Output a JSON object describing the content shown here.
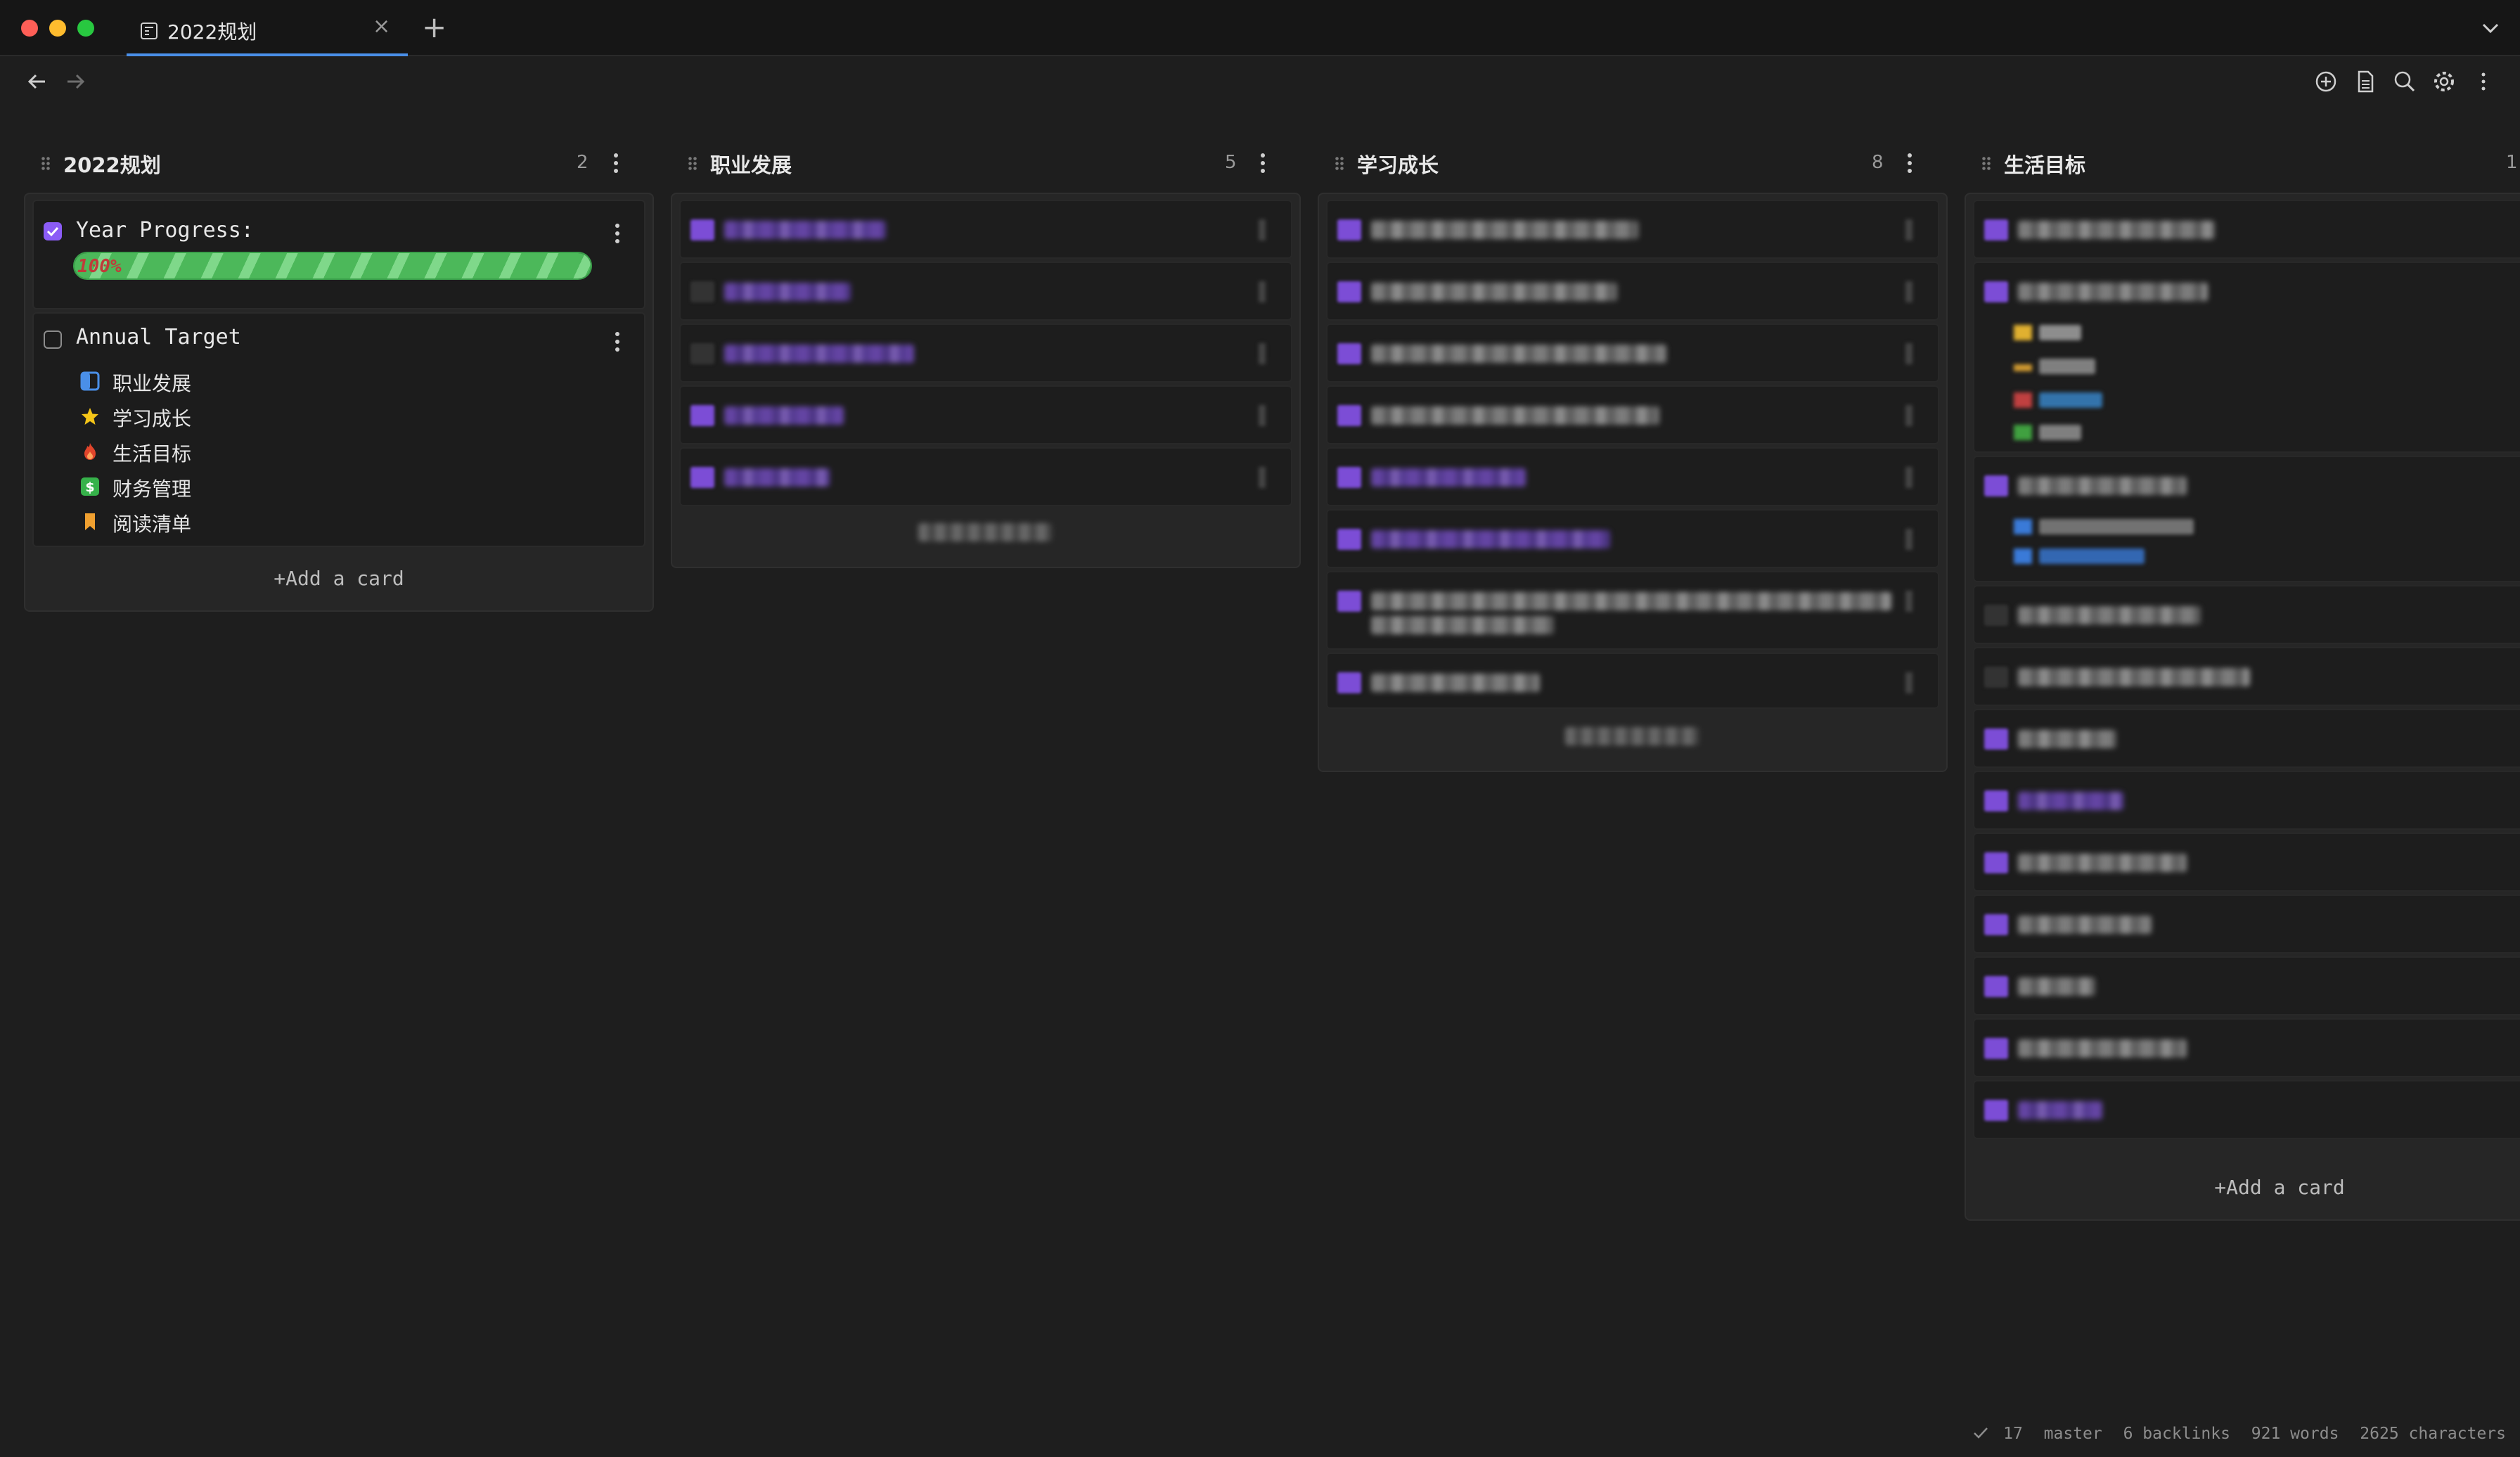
{
  "tab": {
    "title": "2022规划",
    "close": "×",
    "new": "+"
  },
  "columns": [
    {
      "title": "2022规划",
      "count": "2"
    },
    {
      "title": "职业发展",
      "count": "5"
    },
    {
      "title": "学习成长",
      "count": "8"
    },
    {
      "title": "生活目标",
      "count": "1"
    }
  ],
  "year_card": {
    "title": "Year Progress:",
    "checked": true,
    "progress_label": "100%",
    "progress": 1.0
  },
  "annual_card": {
    "title": "Annual Target",
    "checked": false,
    "items": [
      {
        "icon": "half-square-icon",
        "label": "职业发展",
        "color": "#4a8fe8"
      },
      {
        "icon": "star-icon",
        "label": "学习成长",
        "color": "#f5c518"
      },
      {
        "icon": "fire-icon",
        "label": "生活目标",
        "color": "#e2452b"
      },
      {
        "icon": "dollar-icon",
        "label": "财务管理",
        "color": "#36b24a"
      },
      {
        "icon": "bookmark-icon",
        "label": "阅读清单",
        "color": "#f0a030"
      }
    ]
  },
  "add_card_label": "+Add a card",
  "status": {
    "sync": "17",
    "branch": "master",
    "backlinks": "6 backlinks",
    "words": "921 words",
    "characters": "2625 characters"
  },
  "colors": {
    "accent": "#8b5cf6",
    "tab_underline": "#4a8fe8",
    "progress": "#4cb85a"
  }
}
